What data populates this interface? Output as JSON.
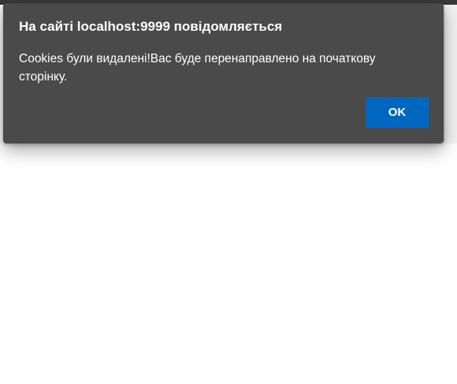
{
  "dialog": {
    "title": "На сайті localhost:9999 повідомляється",
    "message": "Cookies були видалені!Вас буде перенаправлено на початкову сторінку.",
    "ok_label": "OK"
  },
  "colors": {
    "dialog_background": "#4a4a4a",
    "button_accent": "#0067c0",
    "page_background": "#ffffff"
  }
}
